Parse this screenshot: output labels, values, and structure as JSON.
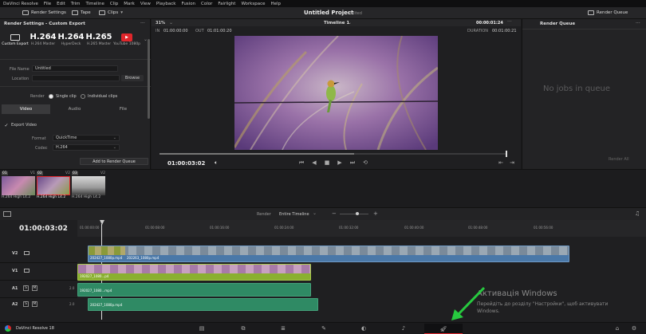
{
  "menu": [
    "DaVinci Resolve",
    "File",
    "Edit",
    "Trim",
    "Timeline",
    "Clip",
    "Mark",
    "View",
    "Playback",
    "Fusion",
    "Color",
    "Fairlight",
    "Workspace",
    "Help"
  ],
  "toolbar": {
    "render_settings": "Render Settings",
    "tape": "Tape",
    "clips": "Clips",
    "project_title": "Untitled Project",
    "edited": "Edited",
    "render_queue": "Render Queue"
  },
  "render_settings": {
    "title": "Render Settings - Custom Export",
    "presets": [
      {
        "big": "",
        "label": "Custom Export"
      },
      {
        "big": "H.264",
        "label": "H.264 Master"
      },
      {
        "big": "H.264",
        "label": "HyperDeck"
      },
      {
        "big": "H.265",
        "label": "H.265 Master"
      },
      {
        "big": "",
        "label": "YouTube 1080p"
      }
    ],
    "file_name_label": "File Name",
    "file_name_value": "Untitled",
    "location_label": "Location",
    "browse": "Browse",
    "render_label": "Render",
    "single_clip": "Single clip",
    "individual_clips": "Individual clips",
    "tabs": [
      "Video",
      "Audio",
      "File"
    ],
    "export_video": "Export Video",
    "format_label": "Format",
    "format_value": "QuickTime",
    "codec_label": "Codec",
    "codec_value": "H.264",
    "add_to_queue": "Add to Render Queue"
  },
  "viewer": {
    "zoom": "31%",
    "timeline_name": "Timeline 1",
    "timecode_top": "00:00:01:24",
    "in_label": "IN",
    "in_value": "01:00:00:00",
    "out_label": "OUT",
    "out_value": "01:01:00:20",
    "duration_label": "DURATION",
    "duration_value": "00:01:00:21",
    "current_tc": "01:00:03:02",
    "progress": 0.56
  },
  "render_queue": {
    "title": "Render Queue",
    "empty": "No jobs in queue",
    "render_all": "Render All"
  },
  "clips": [
    {
      "num": "01",
      "track": "V1",
      "label": "H.264 High L4.2"
    },
    {
      "num": "02",
      "track": "V2",
      "label": "H.264 High L4.2"
    },
    {
      "num": "03",
      "track": "V2",
      "label": "H.264 High L4.2"
    }
  ],
  "timeline": {
    "render_label": "Render",
    "render_value": "Entire Timeline",
    "timecode": "01:00:03:02",
    "ruler": [
      "01:00:00:00",
      "01:00:08:00",
      "01:00:16:00",
      "01:00:24:00",
      "01:00:32:00",
      "01:00:40:00",
      "01:00:48:00",
      "01:00:56:00"
    ],
    "tracks": [
      {
        "name": "V2",
        "clip": "202427_1080p.mp4",
        "clip2": "202263_1080p.mp4"
      },
      {
        "name": "V1",
        "clip": "192027_1080...p4"
      },
      {
        "name": "A1",
        "clip": "192027_1080...mp4",
        "num": "2.0"
      },
      {
        "name": "A2",
        "clip": "202427_1080p.mp4",
        "num": "2.0"
      }
    ]
  },
  "watermark": {
    "title": "Активація Windows",
    "line1": "Перейдіть до розділу \"Настройки\", щоб активувати",
    "line2": "Windows."
  },
  "footer": {
    "app": "DaVinci Resolve 18"
  },
  "colors": {
    "accent_red": "#e0262b",
    "v2": "#4a78a8",
    "v1": "#8ab030",
    "audio": "#2f8a64",
    "arrow": "#27c93f"
  }
}
